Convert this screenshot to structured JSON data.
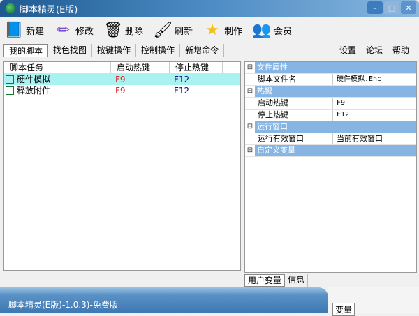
{
  "window": {
    "title": "脚本精灵(E版)",
    "minimize": "–",
    "maximize": "□",
    "close": "✕"
  },
  "toolbar": [
    {
      "label": "新建",
      "icon": "new-book-icon",
      "glyph": "📘"
    },
    {
      "label": "修改",
      "icon": "edit-pen-icon",
      "glyph": "✏"
    },
    {
      "label": "删除",
      "icon": "recycle-bin-icon",
      "glyph": "🗑"
    },
    {
      "label": "刷新",
      "icon": "refresh-brush-icon",
      "glyph": "🖌"
    },
    {
      "label": "制作",
      "icon": "star-icon",
      "glyph": "★"
    },
    {
      "label": "会员",
      "icon": "members-key-icon",
      "glyph": "👥"
    }
  ],
  "tabs": [
    "我的脚本",
    "找色找图",
    "按键操作",
    "控制操作",
    "新增命令"
  ],
  "links": [
    "设置",
    "论坛",
    "帮助"
  ],
  "scripts": {
    "headers": [
      "脚本任务",
      "启动热键",
      "停止热键"
    ],
    "rows": [
      {
        "name": "硬件模拟",
        "start": "F9",
        "stop": "F12",
        "selected": true
      },
      {
        "name": "释放附件",
        "start": "F9",
        "stop": "F12",
        "selected": false
      }
    ]
  },
  "properties": {
    "cat1": "文件属性",
    "file_key": "脚本文件名",
    "file_val": "硬件模拟.Enc",
    "cat2": "热键",
    "start_key": "启动热键",
    "start_val": "F9",
    "stop_key": "停止热键",
    "stop_val": "F12",
    "cat3": "运行窗口",
    "win_key": "运行有效窗口",
    "win_val": "当前有效窗口",
    "cat4": "自定义变量",
    "collapse": "⊟"
  },
  "bottom_tabs": [
    "用户变量",
    "信息"
  ],
  "status": "脚本精灵(E版)-1.0.3)-免费版",
  "glitch_tab": "变量"
}
